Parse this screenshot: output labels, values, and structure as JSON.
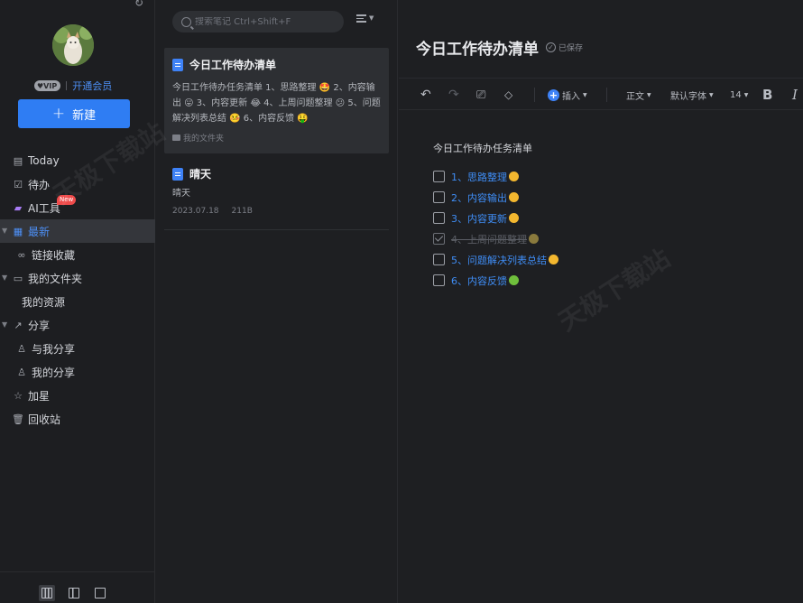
{
  "sidebar": {
    "vip_badge": "VIP",
    "open_vip": "开通会员",
    "new_button": "新建",
    "nav": [
      {
        "label": "Today",
        "icon": "calendar-icon"
      },
      {
        "label": "待办",
        "icon": "checkbox-icon"
      },
      {
        "label": "AI工具",
        "icon": "ai-icon",
        "tag": "New"
      },
      {
        "label": "最新",
        "icon": "grid-icon",
        "active": true
      },
      {
        "label": "链接收藏",
        "icon": "link-icon"
      },
      {
        "label": "我的文件夹",
        "icon": "folder-icon"
      },
      {
        "label": "我的资源",
        "icon": ""
      },
      {
        "label": "分享",
        "icon": "share-icon"
      },
      {
        "label": "与我分享",
        "icon": "user-icon"
      },
      {
        "label": "我的分享",
        "icon": "user-icon"
      },
      {
        "label": "加星",
        "icon": "star-icon"
      },
      {
        "label": "回收站",
        "icon": "trash-icon"
      }
    ]
  },
  "notelist": {
    "search_placeholder": "搜索笔记 Ctrl+Shift+F",
    "notes": [
      {
        "title": "今日工作待办清单",
        "snippet": "今日工作待办任务清单 1、思路整理 🤩 2、内容输出 😛 3、内容更新 😂 4、上周问题整理 😕 5、问题解决列表总结 🤒 6、内容反馈 🤑",
        "folder": "我的文件夹"
      },
      {
        "title": "晴天",
        "snippet": "晴天",
        "date": "2023.07.18",
        "size": "211B"
      }
    ]
  },
  "editor": {
    "title": "今日工作待办清单",
    "saved": "已保存",
    "toolbar": {
      "insert": "插入",
      "paragraph": "正文",
      "font": "默认字体",
      "size": "14",
      "bold": "B",
      "italic": "I"
    },
    "heading": "今日工作待办任务清单",
    "tasks": [
      {
        "text": "1、思路整理",
        "done": false
      },
      {
        "text": "2、内容输出",
        "done": false
      },
      {
        "text": "3、内容更新",
        "done": false
      },
      {
        "text": "4、上周问题整理",
        "done": true
      },
      {
        "text": "5、问题解决列表总结",
        "done": false
      },
      {
        "text": "6、内容反馈",
        "done": false
      }
    ]
  },
  "watermark": "天极下载站",
  "colors": {
    "accent": "#2f7df3",
    "link": "#3f8df5",
    "background": "#1e1f22",
    "selected": "#2d2f33"
  }
}
